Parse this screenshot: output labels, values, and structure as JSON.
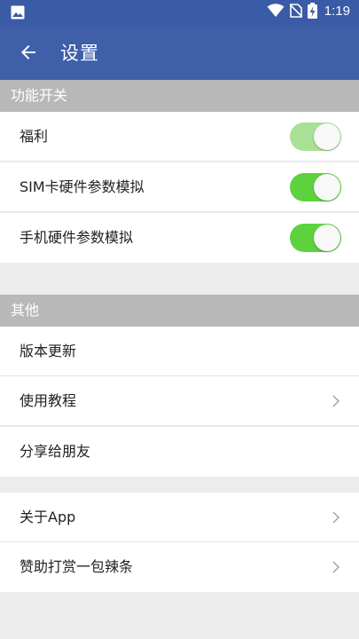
{
  "status_bar": {
    "time": "1:19",
    "icons": [
      "image-icon",
      "wifi-icon",
      "no-sim-icon",
      "battery-charging-icon"
    ]
  },
  "app_bar": {
    "title": "设置",
    "back_icon": "arrow-left-icon"
  },
  "colors": {
    "primary": "#3f5fa8",
    "status_bar": "#3a5ba5",
    "toggle_on": "#5dd23f",
    "toggle_on_light": "#a8e095",
    "section_header": "#b8b8b8"
  },
  "sections": [
    {
      "header": "功能开关",
      "items": [
        {
          "label": "福利",
          "toggle": true,
          "toggle_style": "light"
        },
        {
          "label": "SIM卡硬件参数模拟",
          "toggle": true
        },
        {
          "label": "手机硬件参数模拟",
          "toggle": true
        }
      ]
    },
    {
      "header": "其他",
      "items": [
        {
          "label": "版本更新"
        },
        {
          "label": "使用教程",
          "chevron": true
        },
        {
          "label": "分享给朋友"
        }
      ]
    },
    {
      "header": "",
      "items": [
        {
          "label": "关于App",
          "chevron": true
        },
        {
          "label": "赞助打赏一包辣条",
          "chevron": true
        }
      ]
    }
  ]
}
